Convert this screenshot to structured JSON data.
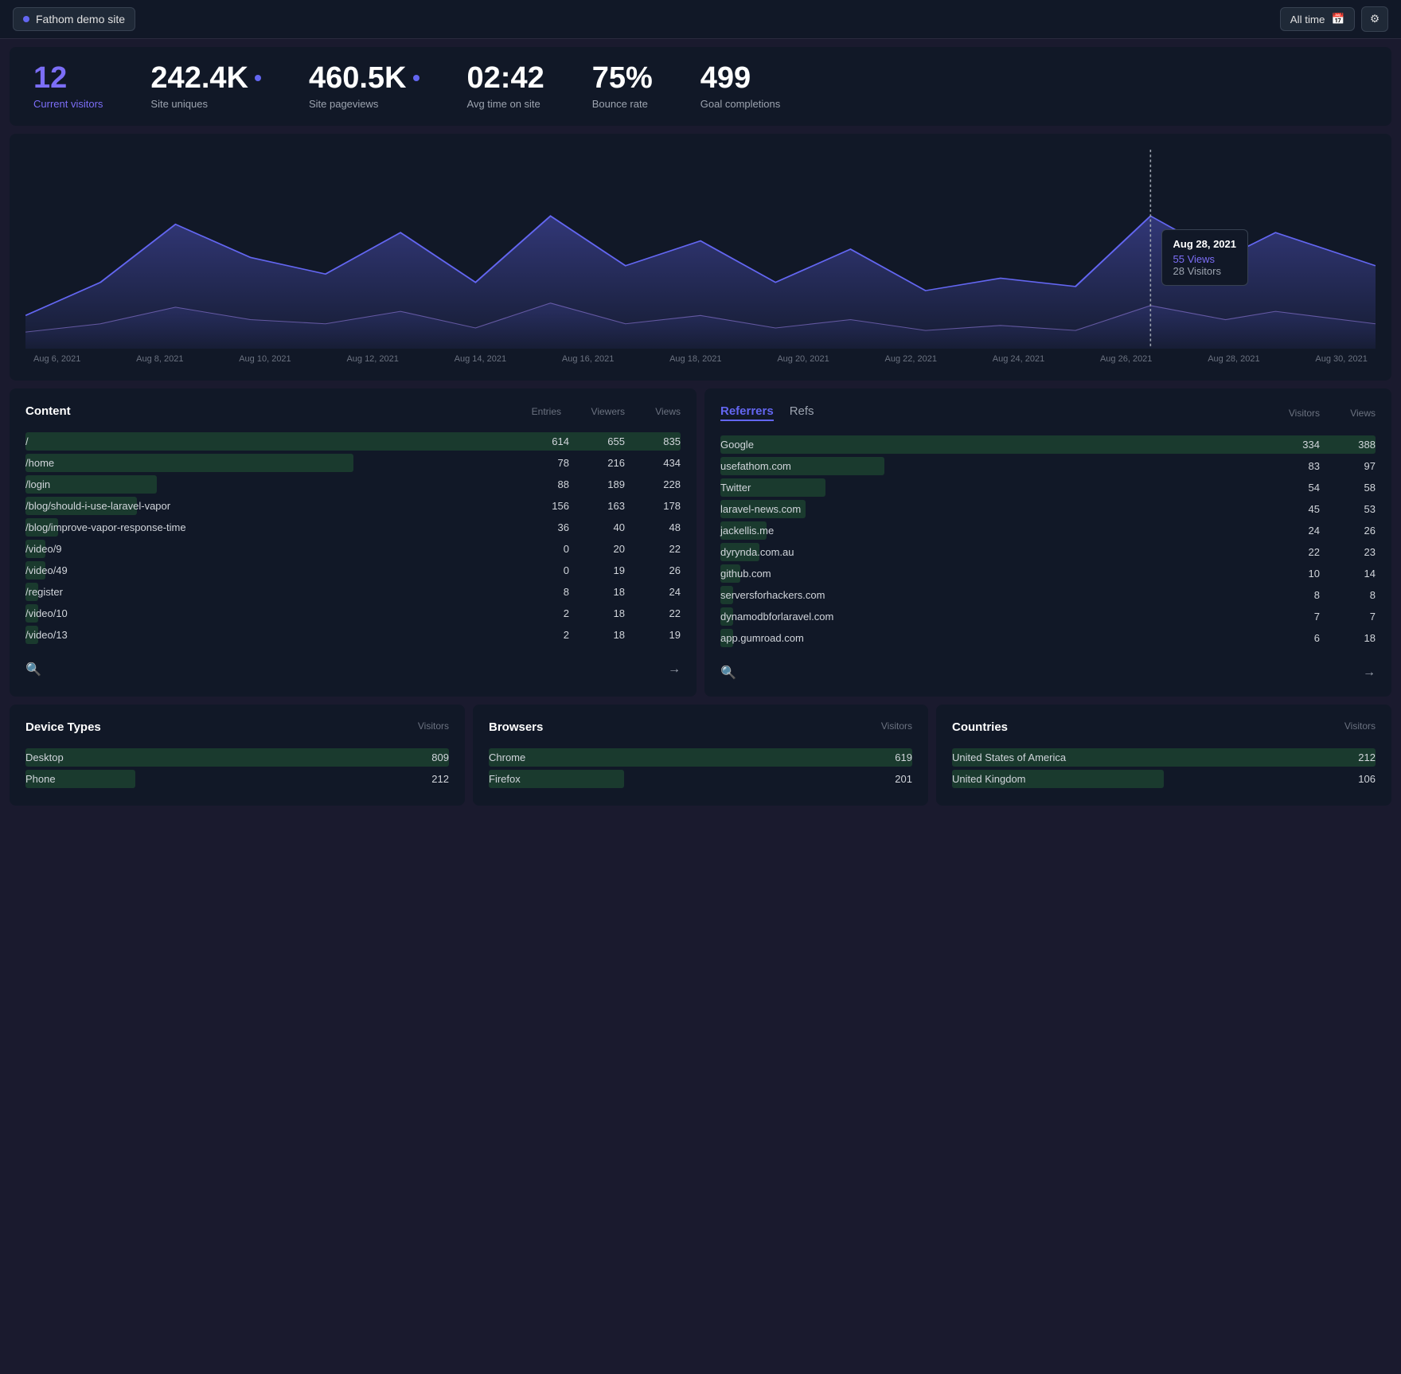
{
  "header": {
    "site_name": "Fathom demo site",
    "date_range": "All time",
    "calendar_icon": "📅",
    "settings_icon": "⚙"
  },
  "stats": {
    "current_visitors": {
      "value": "12",
      "label": "Current visitors"
    },
    "site_uniques": {
      "value": "242.4K",
      "label": "Site uniques"
    },
    "site_pageviews": {
      "value": "460.5K",
      "label": "Site pageviews"
    },
    "avg_time": {
      "value": "02:42",
      "label": "Avg time on site"
    },
    "bounce_rate": {
      "value": "75%",
      "label": "Bounce rate"
    },
    "goal_completions": {
      "value": "499",
      "label": "Goal completions"
    }
  },
  "chart": {
    "x_labels": [
      "Aug 6, 2021",
      "Aug 8, 2021",
      "Aug 10, 2021",
      "Aug 12, 2021",
      "Aug 14, 2021",
      "Aug 16, 2021",
      "Aug 18, 2021",
      "Aug 20, 2021",
      "Aug 22, 2021",
      "Aug 24, 2021",
      "Aug 26, 2021",
      "Aug 28, 2021",
      "Aug 30, 2021"
    ],
    "tooltip": {
      "date": "Aug 28, 2021",
      "views_label": "55 Views",
      "visitors_label": "28 Visitors"
    }
  },
  "content_table": {
    "title": "Content",
    "col_headers": [
      "Entries",
      "Viewers",
      "Views"
    ],
    "rows": [
      {
        "name": "/",
        "entries": "614",
        "viewers": "655",
        "views": "835",
        "bar_pct": 100
      },
      {
        "name": "/home",
        "entries": "78",
        "viewers": "216",
        "views": "434",
        "bar_pct": 50
      },
      {
        "name": "/login",
        "entries": "88",
        "viewers": "189",
        "views": "228",
        "bar_pct": 20
      },
      {
        "name": "/blog/should-i-use-laravel-vapor",
        "entries": "156",
        "viewers": "163",
        "views": "178",
        "bar_pct": 17
      },
      {
        "name": "/blog/improve-vapor-response-time",
        "entries": "36",
        "viewers": "40",
        "views": "48",
        "bar_pct": 5
      },
      {
        "name": "/video/9",
        "entries": "0",
        "viewers": "20",
        "views": "22",
        "bar_pct": 3
      },
      {
        "name": "/video/49",
        "entries": "0",
        "viewers": "19",
        "views": "26",
        "bar_pct": 3
      },
      {
        "name": "/register",
        "entries": "8",
        "viewers": "18",
        "views": "24",
        "bar_pct": 2
      },
      {
        "name": "/video/10",
        "entries": "2",
        "viewers": "18",
        "views": "22",
        "bar_pct": 2
      },
      {
        "name": "/video/13",
        "entries": "2",
        "viewers": "18",
        "views": "19",
        "bar_pct": 2
      }
    ]
  },
  "referrers_table": {
    "tab_active": "Referrers",
    "tab_inactive": "Refs",
    "col_headers": [
      "Visitors",
      "Views"
    ],
    "rows": [
      {
        "name": "Google",
        "visitors": "334",
        "views": "388",
        "bar_pct": 100
      },
      {
        "name": "usefathom.com",
        "visitors": "83",
        "views": "97",
        "bar_pct": 25
      },
      {
        "name": "Twitter",
        "visitors": "54",
        "views": "58",
        "bar_pct": 16
      },
      {
        "name": "laravel-news.com",
        "visitors": "45",
        "views": "53",
        "bar_pct": 13
      },
      {
        "name": "jackellis.me",
        "visitors": "24",
        "views": "26",
        "bar_pct": 7
      },
      {
        "name": "dyrynda.com.au",
        "visitors": "22",
        "views": "23",
        "bar_pct": 6
      },
      {
        "name": "github.com",
        "visitors": "10",
        "views": "14",
        "bar_pct": 3
      },
      {
        "name": "serversforhackers.com",
        "visitors": "8",
        "views": "8",
        "bar_pct": 2
      },
      {
        "name": "dynamodbforlaravel.com",
        "visitors": "7",
        "views": "7",
        "bar_pct": 2
      },
      {
        "name": "app.gumroad.com",
        "visitors": "6",
        "views": "18",
        "bar_pct": 2
      }
    ]
  },
  "device_types": {
    "title": "Device Types",
    "col_header": "Visitors",
    "rows": [
      {
        "name": "Desktop",
        "value": "809",
        "bar_pct": 100
      },
      {
        "name": "Phone",
        "value": "212",
        "bar_pct": 26
      }
    ]
  },
  "browsers": {
    "title": "Browsers",
    "col_header": "Visitors",
    "rows": [
      {
        "name": "Chrome",
        "value": "619",
        "bar_pct": 100
      },
      {
        "name": "Firefox",
        "value": "201",
        "bar_pct": 32
      }
    ]
  },
  "countries": {
    "title": "Countries",
    "col_header": "Visitors",
    "rows": [
      {
        "name": "United States of America",
        "value": "212",
        "bar_pct": 100
      },
      {
        "name": "United Kingdom",
        "value": "106",
        "bar_pct": 50
      }
    ]
  }
}
